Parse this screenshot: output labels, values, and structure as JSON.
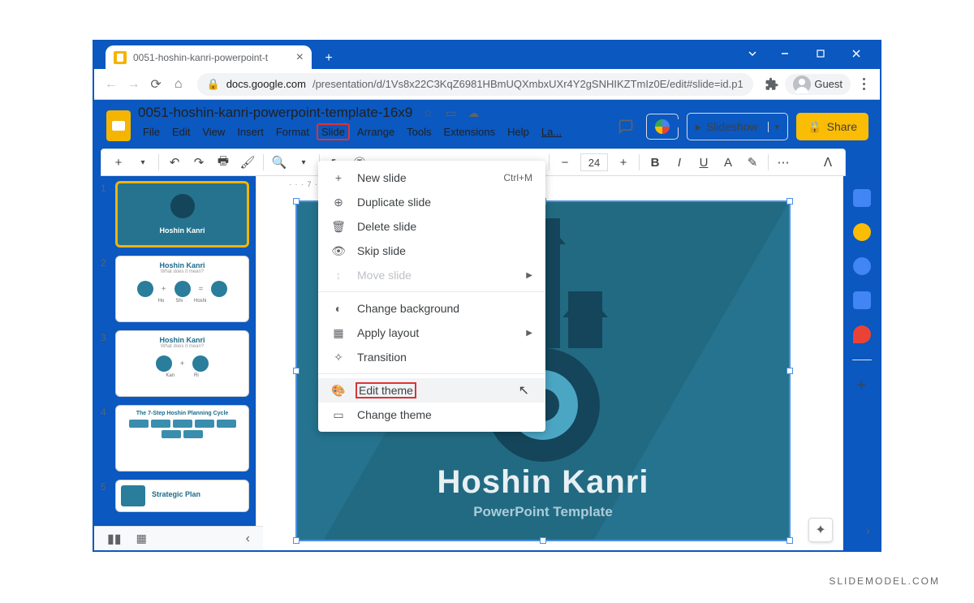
{
  "window": {
    "tab_title": "0051-hoshin-kanri-powerpoint-t",
    "guest": "Guest"
  },
  "url": {
    "host": "docs.google.com",
    "path": "/presentation/d/1Vs8x22C3KqZ6981HBmUQXmbxUXr4Y2gSNHIKZTmIz0E/edit#slide=id.p1"
  },
  "doc": {
    "title": "0051-hoshin-kanri-powerpoint-template-16x9",
    "menus": [
      "File",
      "Edit",
      "View",
      "Insert",
      "Format",
      "Slide",
      "Arrange",
      "Tools",
      "Extensions",
      "Help",
      "La..."
    ],
    "highlighted_menu": "Slide",
    "slideshow": "Slideshow",
    "share": "Share"
  },
  "toolbar": {
    "font_size": "24"
  },
  "dropdown": {
    "items": [
      {
        "ico": "+",
        "label": "New slide",
        "shortcut": "Ctrl+M"
      },
      {
        "ico": "⊕",
        "label": "Duplicate slide"
      },
      {
        "ico": "🗑",
        "label": "Delete slide"
      },
      {
        "ico": "👁",
        "label": "Skip slide"
      },
      {
        "ico": "↕",
        "label": "Move slide",
        "arrow": true,
        "disabled": true
      },
      {
        "sep": true
      },
      {
        "ico": "◐",
        "label": "Change background"
      },
      {
        "ico": "▦",
        "label": "Apply layout",
        "arrow": true
      },
      {
        "ico": "✧",
        "label": "Transition"
      },
      {
        "sep": true
      },
      {
        "ico": "🎨",
        "label": "Edit theme",
        "red": true,
        "hov": true
      },
      {
        "ico": "▭",
        "label": "Change theme"
      }
    ]
  },
  "slide": {
    "title": "Hoshin Kanri",
    "subtitle": "PowerPoint Template"
  },
  "thumbs": {
    "t1": {
      "title": "Hoshin Kanri"
    },
    "t2": {
      "title": "Hoshin Kanri",
      "sub": "What does it mean?",
      "labels": [
        "Ho",
        "Shi",
        "Hoshi"
      ]
    },
    "t3": {
      "title": "Hoshin Kanri",
      "sub": "What does it mean?",
      "labels": [
        "Kan",
        "Ri"
      ]
    },
    "t4": {
      "title": "The 7-Step Hoshin Planning Cycle"
    },
    "t5": {
      "title": "Strategic Plan"
    }
  },
  "watermark": "SLIDEMODEL.COM"
}
